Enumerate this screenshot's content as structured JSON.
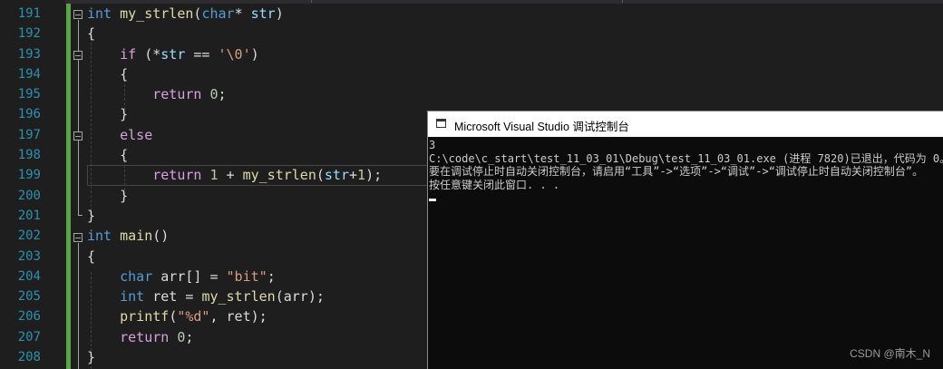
{
  "editor": {
    "line_numbers": [
      "191",
      "192",
      "193",
      "194",
      "195",
      "196",
      "197",
      "198",
      "199",
      "200",
      "201",
      "202",
      "203",
      "204",
      "205",
      "206",
      "207",
      "208"
    ],
    "lines": [
      {
        "tokens": [
          {
            "c": "kw",
            "t": "int"
          },
          {
            "c": "",
            "t": " "
          },
          {
            "c": "fn",
            "t": "my_strlen"
          },
          {
            "c": "",
            "t": "("
          },
          {
            "c": "kw",
            "t": "char"
          },
          {
            "c": "",
            "t": "* "
          },
          {
            "c": "prm",
            "t": "str"
          },
          {
            "c": "",
            "t": ")"
          }
        ]
      },
      {
        "tokens": [
          {
            "c": "",
            "t": "{"
          }
        ]
      },
      {
        "tokens": [
          {
            "c": "",
            "t": "    "
          },
          {
            "c": "ctl",
            "t": "if"
          },
          {
            "c": "",
            "t": " (*"
          },
          {
            "c": "prm",
            "t": "str"
          },
          {
            "c": "",
            "t": " == "
          },
          {
            "c": "str",
            "t": "'\\0'"
          },
          {
            "c": "",
            "t": ")"
          }
        ]
      },
      {
        "tokens": [
          {
            "c": "",
            "t": "    {"
          }
        ]
      },
      {
        "tokens": [
          {
            "c": "",
            "t": "        "
          },
          {
            "c": "ctl",
            "t": "return"
          },
          {
            "c": "",
            "t": " "
          },
          {
            "c": "num",
            "t": "0"
          },
          {
            "c": "",
            "t": ";"
          }
        ]
      },
      {
        "tokens": [
          {
            "c": "",
            "t": "    }"
          }
        ]
      },
      {
        "tokens": [
          {
            "c": "",
            "t": "    "
          },
          {
            "c": "ctl",
            "t": "else"
          }
        ]
      },
      {
        "tokens": [
          {
            "c": "",
            "t": "    {"
          }
        ]
      },
      {
        "tokens": [
          {
            "c": "",
            "t": "        "
          },
          {
            "c": "ctl",
            "t": "return"
          },
          {
            "c": "",
            "t": " "
          },
          {
            "c": "num",
            "t": "1"
          },
          {
            "c": "",
            "t": " + "
          },
          {
            "c": "fn",
            "t": "my_strlen"
          },
          {
            "c": "",
            "t": "("
          },
          {
            "c": "prm",
            "t": "str"
          },
          {
            "c": "",
            "t": "+"
          },
          {
            "c": "num",
            "t": "1"
          },
          {
            "c": "",
            "t": ");"
          }
        ]
      },
      {
        "tokens": [
          {
            "c": "",
            "t": "    }"
          }
        ]
      },
      {
        "tokens": [
          {
            "c": "",
            "t": "}"
          }
        ]
      },
      {
        "tokens": [
          {
            "c": "kw",
            "t": "int"
          },
          {
            "c": "",
            "t": " "
          },
          {
            "c": "fn",
            "t": "main"
          },
          {
            "c": "",
            "t": "()"
          }
        ]
      },
      {
        "tokens": [
          {
            "c": "",
            "t": "{"
          }
        ]
      },
      {
        "tokens": [
          {
            "c": "",
            "t": "    "
          },
          {
            "c": "kw",
            "t": "char"
          },
          {
            "c": "",
            "t": " arr[] = "
          },
          {
            "c": "str",
            "t": "\"bit\""
          },
          {
            "c": "",
            "t": ";"
          }
        ]
      },
      {
        "tokens": [
          {
            "c": "",
            "t": "    "
          },
          {
            "c": "kw",
            "t": "int"
          },
          {
            "c": "",
            "t": " ret = "
          },
          {
            "c": "fn",
            "t": "my_strlen"
          },
          {
            "c": "",
            "t": "(arr);"
          }
        ]
      },
      {
        "tokens": [
          {
            "c": "",
            "t": "    "
          },
          {
            "c": "fn",
            "t": "printf"
          },
          {
            "c": "",
            "t": "("
          },
          {
            "c": "str",
            "t": "\"%d\""
          },
          {
            "c": "",
            "t": ", ret);"
          }
        ]
      },
      {
        "tokens": [
          {
            "c": "",
            "t": "    "
          },
          {
            "c": "ctl",
            "t": "return"
          },
          {
            "c": "",
            "t": " "
          },
          {
            "c": "num",
            "t": "0"
          },
          {
            "c": "",
            "t": ";"
          }
        ]
      },
      {
        "tokens": [
          {
            "c": "",
            "t": "}"
          }
        ]
      }
    ],
    "current_line": "199",
    "colors": {
      "line_number": "#2b91af",
      "keyword": "#569cd6",
      "control": "#d8a0df",
      "function": "#dcdcaa",
      "string": "#d69d85",
      "number": "#b5cea8",
      "change_bar": "#57a64a"
    }
  },
  "console": {
    "title": "Microsoft Visual Studio 调试控制台",
    "lines": [
      "3",
      "C:\\code\\c_start\\test_11_03_01\\Debug\\test_11_03_01.exe (进程 7820)已退出，代码为 0。",
      "要在调试停止时自动关闭控制台，请启用“工具”->“选项”->“调试”->“调试停止时自动关闭控制台”。",
      "按任意键关闭此窗口. . ."
    ],
    "icon": "console-app-icon"
  },
  "watermark": "CSDN @南木_N"
}
